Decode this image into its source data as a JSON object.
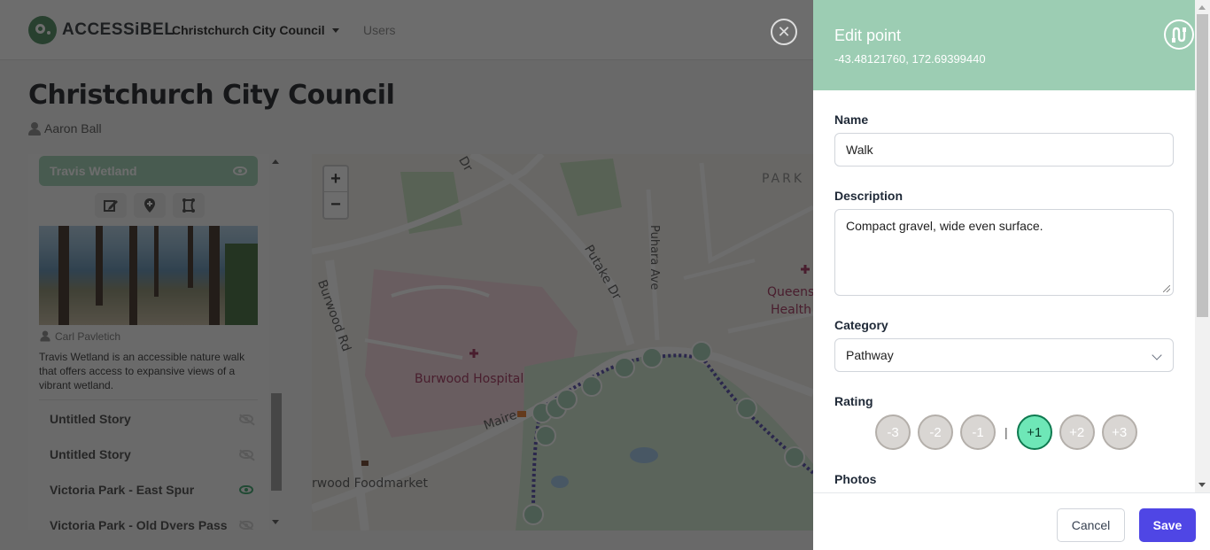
{
  "header": {
    "brand": "ACCESSiBEL",
    "org_selector": "Christchurch City Council",
    "nav_users": "Users"
  },
  "page": {
    "title": "Christchurch City Council",
    "owner": "Aaron Ball"
  },
  "sidebar": {
    "active_story": {
      "title": "Travis Wetland",
      "visible": true,
      "tools": [
        "edit-icon",
        "add-point-icon",
        "route-shape-icon"
      ],
      "photo_credit": "Carl Pavletich",
      "description": "Travis Wetland is an accessible nature walk that offers access to expansive views of a vibrant wetland."
    },
    "stories": [
      {
        "title": "Untitled Story",
        "visible": false
      },
      {
        "title": "Untitled Story",
        "visible": false
      },
      {
        "title": "Victoria Park - East Spur",
        "visible": true
      },
      {
        "title": "Victoria Park - Old Dyers Pass",
        "visible": false
      }
    ]
  },
  "map": {
    "zoom_in": "+",
    "zoom_out": "−",
    "labels": {
      "burwood_rd": "Burwood Rd",
      "putake_dr": "Putake Dr",
      "puhara_ave": "Puhara Ave",
      "hospital": "Burwood Hospital",
      "mairehau": "Maire",
      "foodmarket": "rwood Foodmarket",
      "park": "PARK",
      "queens": "Queens",
      "health": "Health",
      "dr_top": "Dr"
    }
  },
  "overlay": {
    "close_icon": "close-icon"
  },
  "panel": {
    "title": "Edit point",
    "coords": "-43.48121760, 172.69399440",
    "route_icon": "route-icon",
    "name_label": "Name",
    "name_value": "Walk",
    "description_label": "Description",
    "description_value": "Compact gravel, wide even surface.",
    "category_label": "Category",
    "category_value": "Pathway",
    "rating_label": "Rating",
    "rating_options": [
      "-3",
      "-2",
      "-1",
      "+1",
      "+2",
      "+3"
    ],
    "rating_selected": "+1",
    "photos_label": "Photos",
    "cancel_label": "Cancel",
    "save_label": "Save"
  },
  "colors": {
    "accent_green": "#9ccdb3",
    "save_button": "#4f46e5",
    "rating_selected": "#6ee7b7",
    "visible_eye": "#37a26b"
  }
}
